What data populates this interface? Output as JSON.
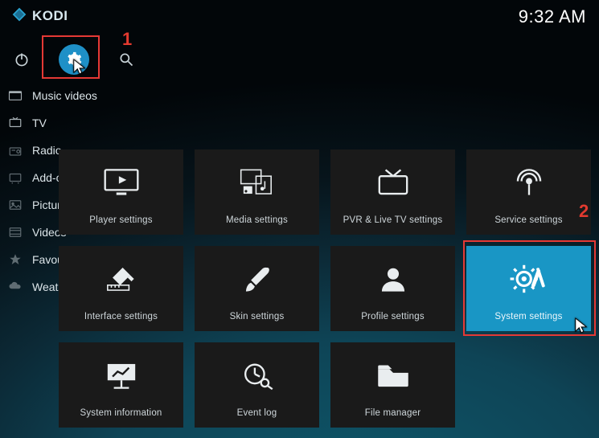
{
  "app_name": "KODI",
  "clock": "9:32 AM",
  "annotations": {
    "step1": "1",
    "step2": "2"
  },
  "sidebar": {
    "items": [
      {
        "label": "Music videos"
      },
      {
        "label": "TV"
      },
      {
        "label": "Radio"
      },
      {
        "label": "Add-ons"
      },
      {
        "label": "Pictures"
      },
      {
        "label": "Videos"
      },
      {
        "label": "Favourites"
      },
      {
        "label": "Weather"
      }
    ]
  },
  "tiles": [
    {
      "label": "Player settings"
    },
    {
      "label": "Media settings"
    },
    {
      "label": "PVR & Live TV settings"
    },
    {
      "label": "Service settings"
    },
    {
      "label": "Interface settings"
    },
    {
      "label": "Skin settings"
    },
    {
      "label": "Profile settings"
    },
    {
      "label": "System settings",
      "selected": true
    },
    {
      "label": "System information"
    },
    {
      "label": "Event log"
    },
    {
      "label": "File manager"
    }
  ]
}
